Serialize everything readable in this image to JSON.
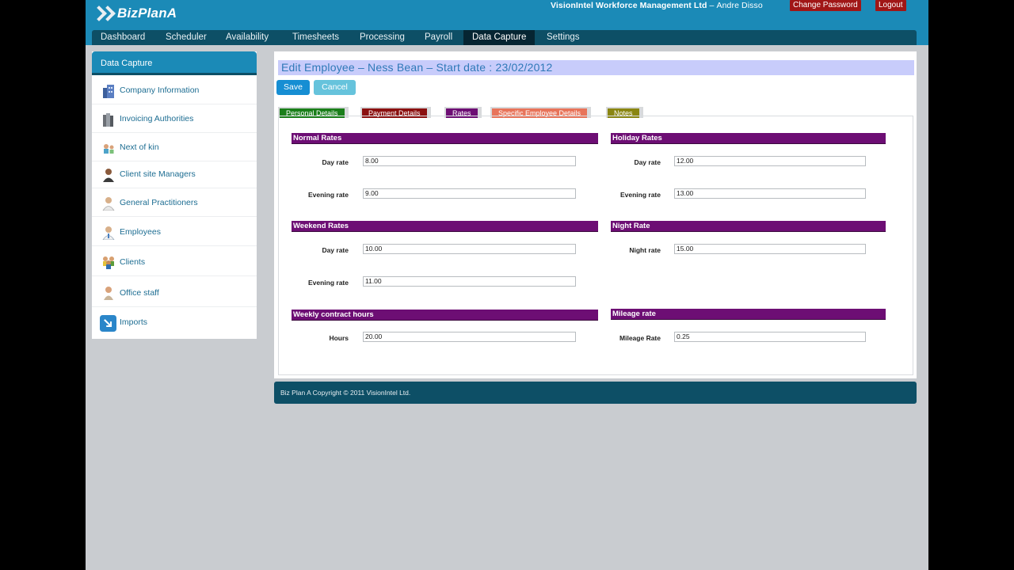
{
  "header": {
    "logo": "BizPlanA",
    "company": "VisionIntel Workforce Management Ltd",
    "separator": "–",
    "user": "Andre Disso",
    "change_password": "Change Password",
    "logout": "Logout"
  },
  "nav": [
    "Dashboard",
    "Scheduler",
    "Availability",
    "Timesheets",
    "Processing",
    "Payroll",
    "Data Capture",
    "Settings"
  ],
  "nav_active": "Data Capture",
  "sidebar": {
    "title": "Data Capture",
    "items": [
      {
        "label": "Company Information",
        "icon": "building-icon"
      },
      {
        "label": "Invoicing Authorities",
        "icon": "books-icon"
      },
      {
        "label": "Next of kin",
        "icon": "family-icon"
      },
      {
        "label": "Client site Managers",
        "icon": "manager-icon"
      },
      {
        "label": "General Practitioners",
        "icon": "doctor-icon"
      },
      {
        "label": "Employees",
        "icon": "employee-icon"
      },
      {
        "label": "Clients",
        "icon": "group-icon"
      },
      {
        "label": "Office staff",
        "icon": "office-staff-icon"
      },
      {
        "label": "Imports",
        "icon": "import-icon"
      }
    ]
  },
  "page": {
    "title": "Edit Employee – Ness Bean – Start date : 23/02/2012",
    "save": "Save",
    "cancel": "Cancel"
  },
  "tabs": [
    {
      "label": "Personal Details",
      "color": "#1a7f1a"
    },
    {
      "label": "Payment Details",
      "color": "#8b1010"
    },
    {
      "label": "Rates",
      "color": "#6d0e74"
    },
    {
      "label": "Specific Employee Details",
      "color": "#e8745a"
    },
    {
      "label": "Notes",
      "color": "#8a8612"
    }
  ],
  "active_tab": "Rates",
  "sections": {
    "normal_rates": {
      "title": "Normal Rates",
      "fields": [
        {
          "label": "Day rate",
          "value": "8.00"
        },
        {
          "label": "Evening rate",
          "value": "9.00"
        }
      ]
    },
    "holiday_rates": {
      "title": "Holiday Rates",
      "fields": [
        {
          "label": "Day rate",
          "value": "12.00"
        },
        {
          "label": "Evening rate",
          "value": "13.00"
        }
      ]
    },
    "weekend_rates": {
      "title": "Weekend Rates",
      "fields": [
        {
          "label": "Day rate",
          "value": "10.00"
        },
        {
          "label": "Evening rate",
          "value": "11.00"
        }
      ]
    },
    "night_rate": {
      "title": "Night Rate",
      "fields": [
        {
          "label": "Night rate",
          "value": "15.00"
        }
      ]
    },
    "weekly_contract": {
      "title": "Weekly contract hours",
      "fields": [
        {
          "label": "Hours",
          "value": "20.00"
        }
      ]
    },
    "mileage_rate": {
      "title": "Mileage rate",
      "fields": [
        {
          "label": "Mileage Rate",
          "value": "0.25"
        }
      ]
    }
  },
  "footer": "Biz Plan A Copyright © 2011 VisionIntel Ltd."
}
